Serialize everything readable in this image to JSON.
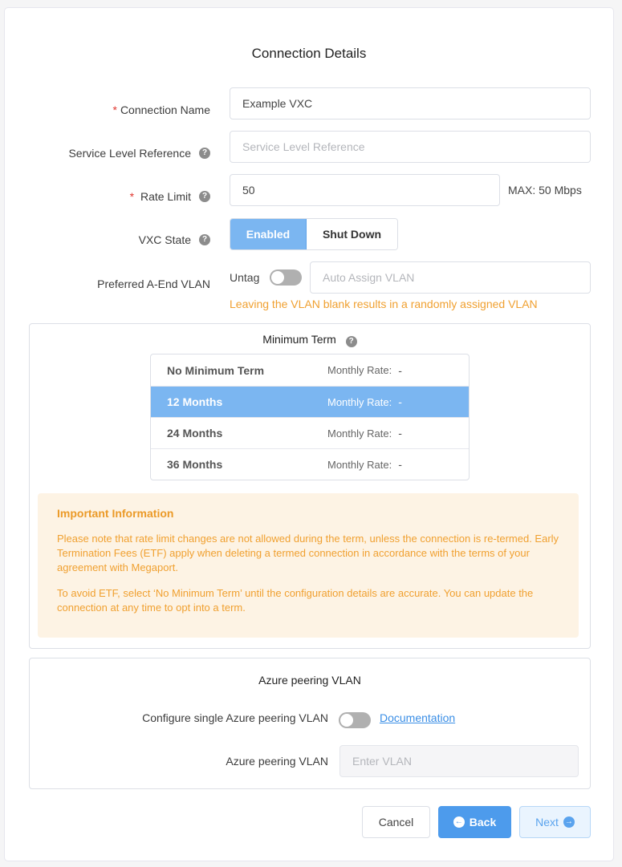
{
  "title": "Connection Details",
  "form": {
    "connection_name": {
      "label": "Connection Name",
      "required": true,
      "value": "Example VXC"
    },
    "service_level_reference": {
      "label": "Service Level Reference",
      "placeholder": "Service Level Reference",
      "value": ""
    },
    "rate_limit": {
      "label": "Rate Limit",
      "required": true,
      "value": "50",
      "max_text": "MAX: 50 Mbps"
    },
    "vxc_state": {
      "label": "VXC State",
      "options": [
        "Enabled",
        "Shut Down"
      ],
      "selected": "Enabled"
    },
    "a_end_vlan": {
      "label": "Preferred A-End VLAN",
      "untag_label": "Untag",
      "untag_on": false,
      "placeholder": "Auto Assign VLAN",
      "hint": "Leaving the VLAN blank results in a randomly assigned VLAN"
    },
    "required_marker": "*",
    "help_glyph": "?"
  },
  "minimum_term": {
    "title": "Minimum Term",
    "rate_label": "Monthly Rate:",
    "options": [
      {
        "label": "No Minimum Term",
        "rate": "-"
      },
      {
        "label": "12 Months",
        "rate": "-"
      },
      {
        "label": "24 Months",
        "rate": "-"
      },
      {
        "label": "36 Months",
        "rate": "-"
      }
    ],
    "selected": "12 Months",
    "info": {
      "heading": "Important Information",
      "paragraph1": "Please note that rate limit changes are not allowed during the term, unless the connection is re-termed. Early Termination Fees (ETF) apply when deleting a termed connection in accordance with the terms of your agreement with Megaport.",
      "paragraph2": "To avoid ETF, select ‘No Minimum Term’ until the configuration details are accurate. You can update the connection at any time to opt into a term."
    }
  },
  "azure": {
    "title": "Azure peering VLAN",
    "configure_label": "Configure single Azure peering VLAN",
    "configure_on": false,
    "doc_link": "Documentation",
    "vlan_label": "Azure peering VLAN",
    "vlan_placeholder": "Enter VLAN"
  },
  "footer": {
    "cancel": "Cancel",
    "back": "Back",
    "next": "Next",
    "back_icon": "arrow-left-circle-icon",
    "next_icon": "arrow-right-circle-icon"
  },
  "colors": {
    "accent": "#4d9bec",
    "selected": "#7bb6f1",
    "warning": "#f0a030",
    "required": "#e0362f"
  }
}
